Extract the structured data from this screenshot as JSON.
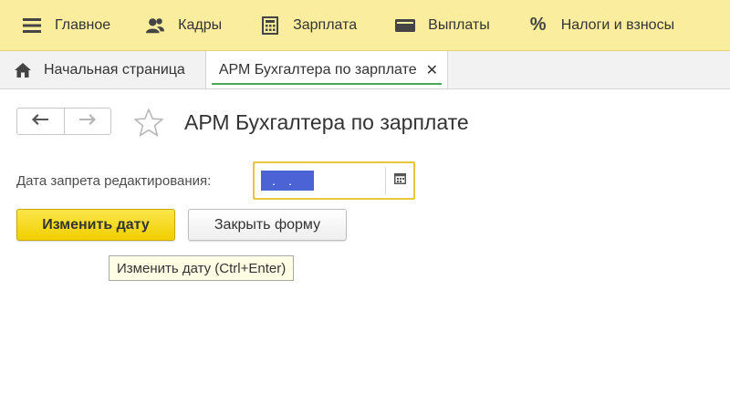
{
  "menu": {
    "items": [
      {
        "label": "Главное",
        "icon": "hamburger-icon"
      },
      {
        "label": "Кадры",
        "icon": "people-icon"
      },
      {
        "label": "Зарплата",
        "icon": "calculator-icon"
      },
      {
        "label": "Выплаты",
        "icon": "wallet-icon"
      },
      {
        "label": "Налоги и взносы",
        "icon": "percent-icon"
      }
    ]
  },
  "tabs": {
    "home_label": "Начальная страница",
    "active_label": "АРМ Бухгалтера по зарплате",
    "close_glyph": "✕"
  },
  "form": {
    "title": "АРМ Бухгалтера по зарплате",
    "date_label": "Дата запрета редактирования:",
    "date_value": "  .  .",
    "change_date_button": "Изменить дату",
    "close_form_button": "Закрыть форму",
    "tooltip": "Изменить дату (Ctrl+Enter)"
  },
  "colors": {
    "menu_bg": "#fbed9e",
    "primary_button": "#f5d800",
    "active_tab_underline": "#4aa55a",
    "focus_border": "#e8c53a",
    "selection": "#4b63d4"
  }
}
